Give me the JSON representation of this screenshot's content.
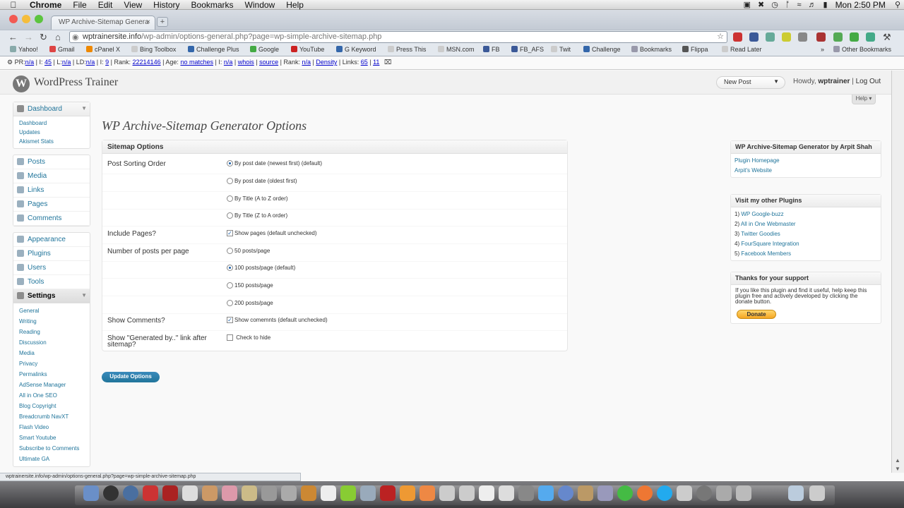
{
  "menubar": {
    "app": "Chrome",
    "items": [
      "File",
      "Edit",
      "View",
      "History",
      "Bookmarks",
      "Window",
      "Help"
    ],
    "clock": "Mon 2:50 PM"
  },
  "browser": {
    "tab_title": "WP Archive-Sitemap Genera",
    "url_host": "wptrainersite.info",
    "url_path": "/wp-admin/options-general.php?page=wp-simple-archive-sitemap.php",
    "bookmarks": [
      "Yahoo!",
      "Gmail",
      "cPanel X",
      "Bing Toolbox",
      "Challenge Plus",
      "Google",
      "YouTube",
      "G Keyword",
      "Press This",
      "MSN.com",
      "FB",
      "FB_AFS",
      "Twit",
      "Challenge",
      "Bookmarks",
      "Flippa",
      "Read Later"
    ],
    "other_bookmarks": "Other Bookmarks",
    "seobar": {
      "pr_label": "PR:",
      "pr": "n/a",
      "i1_label": "I:",
      "i1": "45",
      "l_label": "L:",
      "l": "n/a",
      "ld_label": "LD:",
      "ld": "n/a",
      "i2_label": "I:",
      "i2": "9",
      "rank_label": "Rank:",
      "rank": "22214146",
      "age_label": "Age:",
      "age": "no matches",
      "i3_label": "I:",
      "i3": "n/a",
      "whois": "whois",
      "source": "source",
      "rank2_label": "Rank:",
      "rank2": "n/a",
      "density": "Density",
      "links_label": "Links:",
      "links_a": "65",
      "links_b": "11"
    },
    "status_url": "wptrainersite.info/wp-admin/options-general.php?page=wp-simple-archive-sitemap.php"
  },
  "wp": {
    "site_title": "WordPress Trainer",
    "new_post": "New Post",
    "howdy": "Howdy,",
    "user": "wptrainer",
    "logout": "Log Out",
    "help": "Help"
  },
  "sidebar": {
    "dashboard": {
      "label": "Dashboard",
      "subs": [
        "Dashboard",
        "Updates",
        "Akismet Stats"
      ]
    },
    "group2": [
      "Posts",
      "Media",
      "Links",
      "Pages",
      "Comments"
    ],
    "group3": [
      "Appearance",
      "Plugins",
      "Users",
      "Tools"
    ],
    "settings": {
      "label": "Settings",
      "subs": [
        "General",
        "Writing",
        "Reading",
        "Discussion",
        "Media",
        "Privacy",
        "Permalinks",
        "AdSense Manager",
        "All in One SEO",
        "Blog Copyright",
        "Breadcrumb NavXT",
        "Flash Video",
        "Smart Youtube",
        "Subscribe to Comments",
        "Ultimate GA"
      ]
    }
  },
  "content": {
    "page_title": "WP Archive-Sitemap Generator Options",
    "box_title": "Sitemap Options",
    "sorting_label": "Post Sorting Order",
    "sorting_options": [
      "By post date (newest first) (default)",
      "By post date (oldest first)",
      "By Title (A to Z order)",
      "By Title (Z to A order)"
    ],
    "include_pages_label": "Include Pages?",
    "include_pages_text": "Show pages (default unchecked)",
    "posts_per_page_label": "Number of posts per page",
    "posts_options": [
      "50 posts/page",
      "100 posts/page (default)",
      "150 posts/page",
      "200 posts/page"
    ],
    "show_comments_label": "Show Comments?",
    "show_comments_text": "Show comemnts (default unchecked)",
    "generated_label": "Show \"Generated by..\" link after sitemap?",
    "generated_check": "Check",
    "generated_suffix": "to hide",
    "update_button": "Update Options"
  },
  "widgets": {
    "author": {
      "title": "WP Archive-Sitemap Generator by Arpit Shah",
      "links": [
        "Plugin Homepage",
        "Arpit's Website"
      ]
    },
    "plugins": {
      "title": "Visit my other Plugins",
      "items": [
        {
          "n": "1)",
          "label": "WP Google-buzz"
        },
        {
          "n": "2)",
          "label": "All in One Webmaster"
        },
        {
          "n": "3)",
          "label": "Twitter Goodies"
        },
        {
          "n": "4)",
          "label": "FourSquare Integration"
        },
        {
          "n": "5)",
          "label": "Facebook Members"
        }
      ]
    },
    "support": {
      "title": "Thanks for your support",
      "text": "If you like this plugin and find it useful, help keep this plugin free and actively developed by clicking the donate button.",
      "donate": "Donate"
    }
  },
  "colors": {
    "link": "#21759b",
    "button": "#21759b"
  }
}
